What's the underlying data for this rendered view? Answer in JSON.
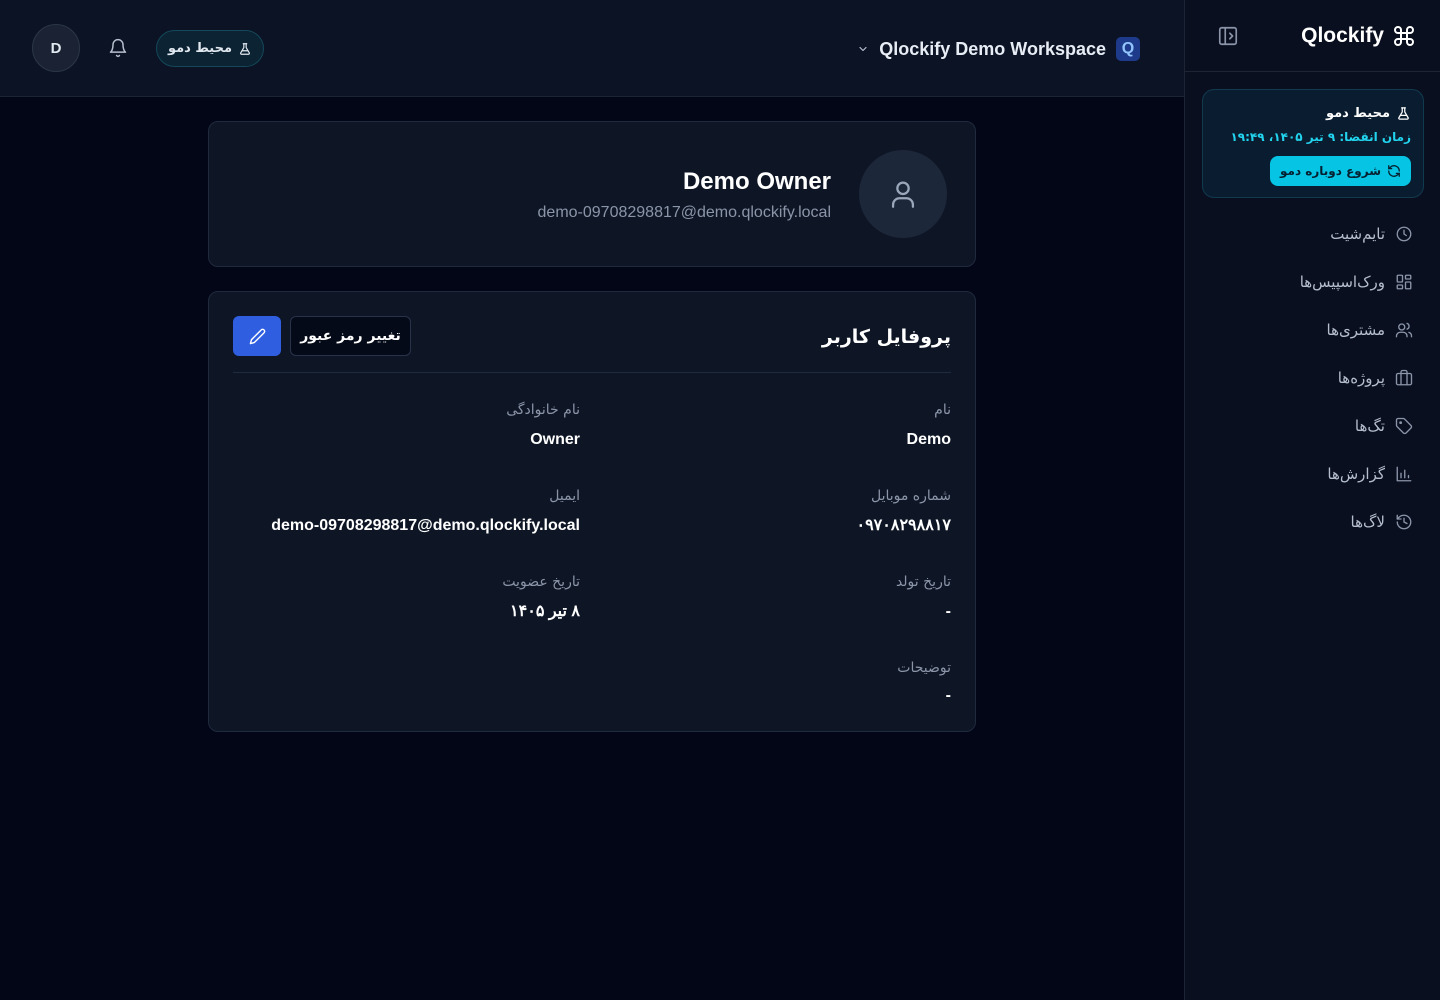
{
  "app": {
    "brand": "Qlockify"
  },
  "header": {
    "avatar_initial": "D",
    "demo_badge": "محیط دمو",
    "workspace_name": "Qlockify Demo Workspace",
    "workspace_initial": "Q"
  },
  "sidebar": {
    "demo": {
      "title": "محیط دمو",
      "expiry": "زمان انقضا: ۹ تیر ۱۴۰۵، ۱۹:۴۹",
      "reset_label": "شروع دوباره دمو"
    },
    "items": [
      {
        "label": "تایم‌شیت",
        "icon": "clock-icon"
      },
      {
        "label": "ورک‌اسپیس‌ها",
        "icon": "grid-icon"
      },
      {
        "label": "مشتری‌ها",
        "icon": "users-icon"
      },
      {
        "label": "پروژه‌ها",
        "icon": "briefcase-icon"
      },
      {
        "label": "تگ‌ها",
        "icon": "tag-icon"
      },
      {
        "label": "گزارش‌ها",
        "icon": "bar-chart-icon"
      },
      {
        "label": "لاگ‌ها",
        "icon": "history-icon"
      }
    ]
  },
  "user_card": {
    "name": "Demo Owner",
    "email": "demo-09708298817@demo.qlockify.local"
  },
  "profile": {
    "title": "پروفایل کاربر",
    "change_password_label": "تغییر رمز عبور",
    "fields": {
      "first_name": {
        "label": "نام",
        "value": "Demo"
      },
      "last_name": {
        "label": "نام خانوادگی",
        "value": "Owner"
      },
      "mobile": {
        "label": "شماره موبایل",
        "value": "۰۹۷۰۸۲۹۸۸۱۷"
      },
      "email": {
        "label": "ایمیل",
        "value": "demo-09708298817@demo.qlockify.local"
      },
      "birth_date": {
        "label": "تاریخ تولد",
        "value": "-"
      },
      "join_date": {
        "label": "تاریخ عضویت",
        "value": "۸ تیر ۱۴۰۵"
      },
      "description": {
        "label": "توضیحات",
        "value": "-"
      }
    }
  },
  "colors": {
    "background": "#030617",
    "panel": "#0e1626",
    "accent_blue": "#2f5fe0",
    "accent_cyan": "#06c4e4"
  }
}
